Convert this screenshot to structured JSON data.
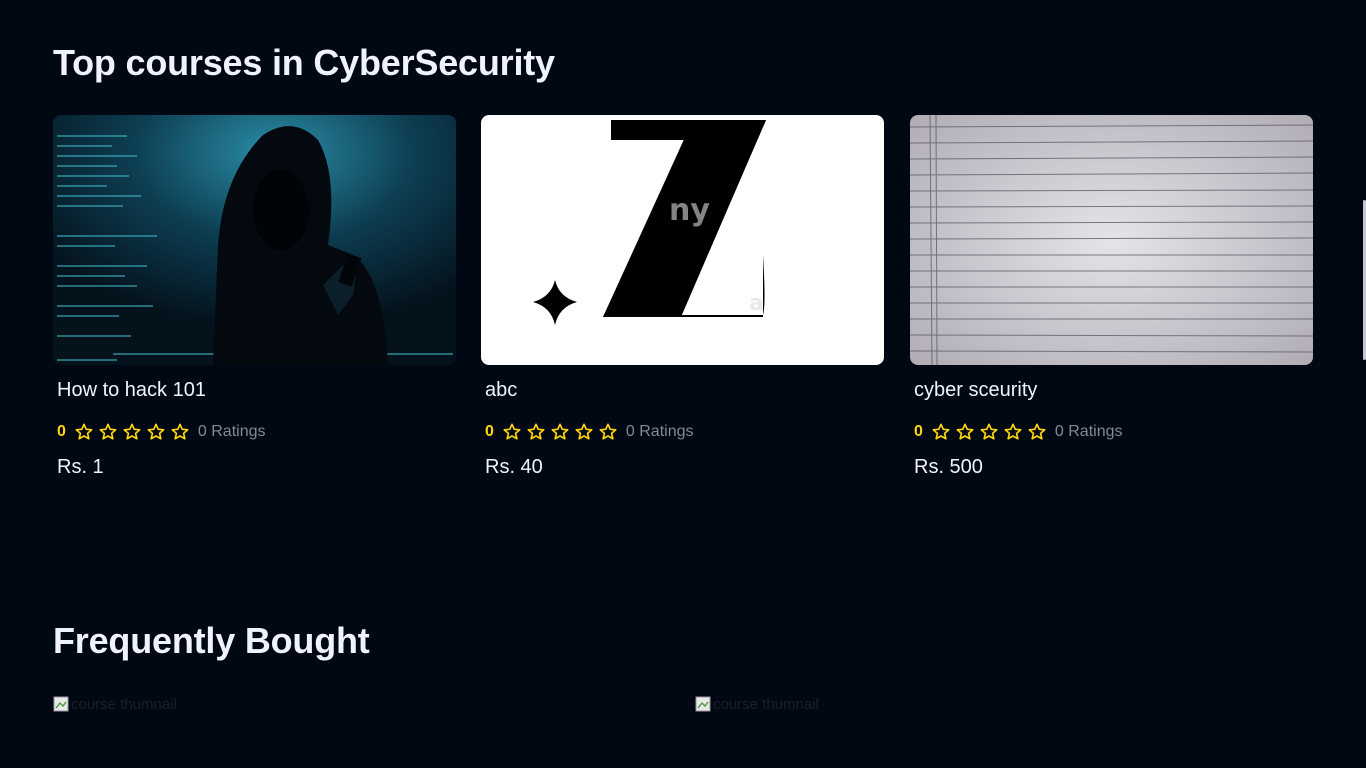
{
  "sections": {
    "top_title": "Top courses in CyberSecurity",
    "frequent_title": "Frequently Bought"
  },
  "courses": [
    {
      "title": "How to hack 101",
      "rating": "0",
      "ratings_label": "0 Ratings",
      "price": "Rs. 1",
      "stars": 5,
      "thumbnail": "hooded-hacker-image"
    },
    {
      "title": "abc",
      "rating": "0",
      "ratings_label": "0 Ratings",
      "price": "Rs. 40",
      "stars": 5,
      "thumbnail": "z-logo-image"
    },
    {
      "title": "cyber sceurity",
      "rating": "0",
      "ratings_label": "0 Ratings",
      "price": "Rs. 500",
      "stars": 5,
      "thumbnail": "lined-paper-image"
    }
  ],
  "frequently_bought": [
    {
      "alt": "course thumnail"
    },
    {
      "alt": "course thumnail"
    }
  ],
  "colors": {
    "background": "#000814",
    "text": "#f1f2ff",
    "rating_yellow": "#ffd60a",
    "muted": "#838894"
  }
}
